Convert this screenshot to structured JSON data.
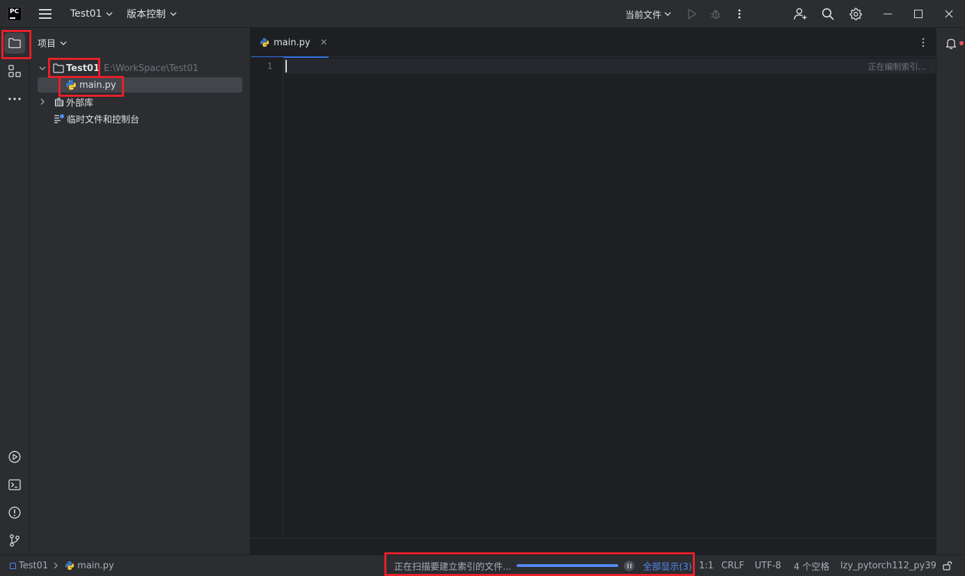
{
  "titlebar": {
    "logo_text": "PC",
    "project_name": "Test01",
    "vcs_label": "版本控制",
    "run_config": "当前文件"
  },
  "left_strip": {
    "items": [
      {
        "icon": "folder-icon",
        "active": true
      },
      {
        "icon": "structure-icon",
        "active": false
      },
      {
        "icon": "more-icon",
        "active": false
      },
      {
        "icon": "run-icon",
        "active": false
      },
      {
        "icon": "terminal-icon",
        "active": false
      },
      {
        "icon": "problems-icon",
        "active": false
      },
      {
        "icon": "git-icon",
        "active": false
      }
    ]
  },
  "project_panel": {
    "title": "项目",
    "root_name": "Test01",
    "root_path": "E:\\WorkSpace\\Test01",
    "file_name": "main.py",
    "external_libs": "外部库",
    "scratches": "临时文件和控制台"
  },
  "editor": {
    "tab_label": "main.py",
    "line_numbers": [
      "1"
    ],
    "index_hint": "正在编制索引..."
  },
  "statusbar": {
    "breadcrumb_project": "Test01",
    "breadcrumb_file": "main.py",
    "scanning_text": "正在扫描要建立索引的文件...",
    "progress": 1.0,
    "show_all": "全部显示(3)",
    "position": "1:1",
    "line_sep": "CRLF",
    "encoding": "UTF-8",
    "indent": "4 个空格",
    "interpreter": "lzy_pytorch112_py39"
  },
  "colors": {
    "accent": "#3574f0",
    "highlight": "#e8202a",
    "notification": "#e55765"
  }
}
